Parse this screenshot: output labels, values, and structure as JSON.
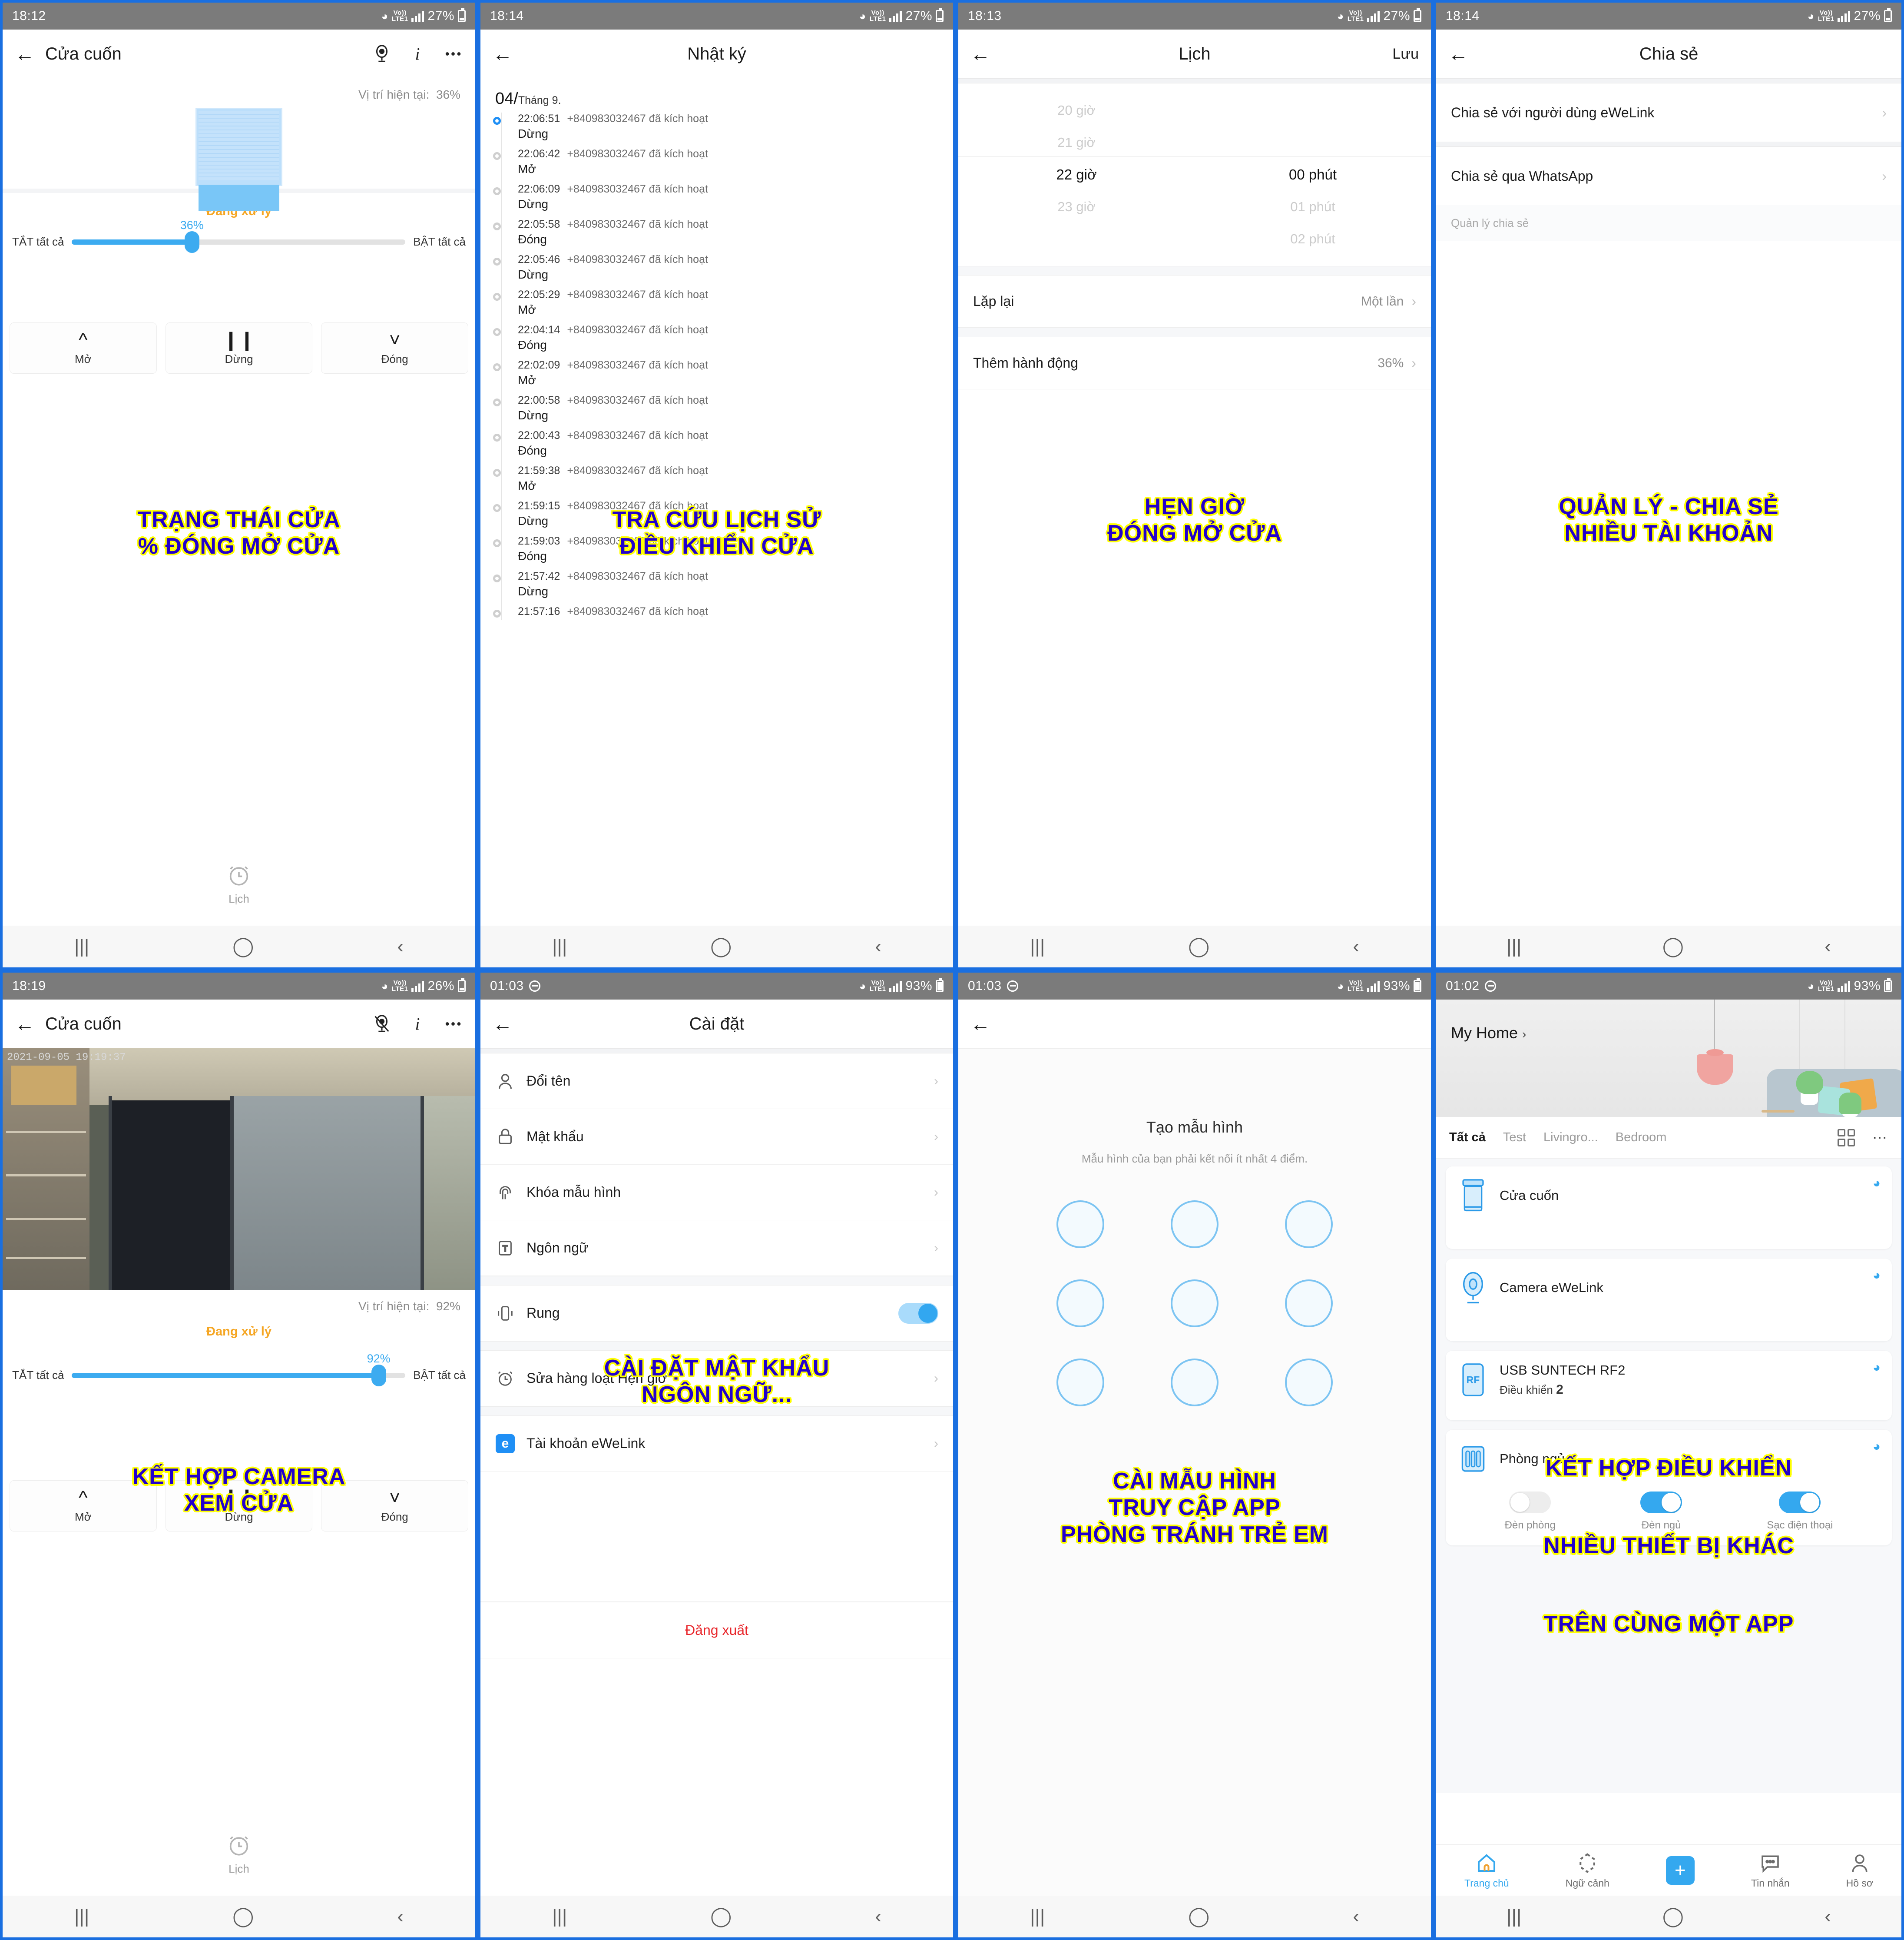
{
  "panels": {
    "cover": {
      "status": {
        "time": "18:12",
        "battery": "27%",
        "network": "LTE1"
      },
      "title": "Cửa cuốn",
      "position_label": "Vị trí hiện tại:",
      "position_value": "36%",
      "state_text": "Đang xử lý",
      "slider": {
        "value": "36%",
        "percent": 36,
        "left_label": "TẮT tất cả",
        "right_label": "BẬT tất cả"
      },
      "controls": [
        {
          "label": "Mở",
          "glyph": "⌃"
        },
        {
          "label": "Dừng",
          "glyph": "▐▌"
        },
        {
          "label": "Đóng",
          "glyph": "⌄"
        }
      ],
      "schedule_label": "Lịch",
      "caption": [
        "TRẠNG THÁI CỬA",
        "% ĐÓNG MỞ CỬA"
      ]
    },
    "log": {
      "status": {
        "time": "18:14",
        "battery": "27%",
        "network": "LTE1"
      },
      "title": "Nhật ký",
      "date_day": "04/",
      "date_month": "Tháng 9.",
      "actor": "+840983032467 đã kích hoạt",
      "entries": [
        {
          "time": "22:06:51",
          "action": "Dừng"
        },
        {
          "time": "22:06:42",
          "action": "Mở"
        },
        {
          "time": "22:06:09",
          "action": "Dừng"
        },
        {
          "time": "22:05:58",
          "action": "Đóng"
        },
        {
          "time": "22:05:46",
          "action": "Dừng"
        },
        {
          "time": "22:05:29",
          "action": "Mở"
        },
        {
          "time": "22:04:14",
          "action": "Đóng"
        },
        {
          "time": "22:02:09",
          "action": "Mở"
        },
        {
          "time": "22:00:58",
          "action": "Dừng"
        },
        {
          "time": "22:00:43",
          "action": "Đóng"
        },
        {
          "time": "21:59:38",
          "action": "Mở"
        },
        {
          "time": "21:59:15",
          "action": "Dừng"
        },
        {
          "time": "21:59:03",
          "action": "Đóng"
        },
        {
          "time": "21:57:42",
          "action": "Dừng"
        },
        {
          "time": "21:57:16",
          "action": ""
        }
      ],
      "caption": [
        "TRA CỨU LỊCH SỬ",
        "ĐIỀU KHIỂN CỬA"
      ]
    },
    "schedule": {
      "status": {
        "time": "18:13",
        "battery": "27%",
        "network": "LTE1"
      },
      "title": "Lịch",
      "save_label": "Lưu",
      "hours": [
        "20 giờ",
        "21 giờ",
        "22 giờ",
        "23 giờ"
      ],
      "selected_hour": "22 giờ",
      "minutes": [
        "00 phút",
        "01 phút",
        "02 phút"
      ],
      "selected_minute": "00 phút",
      "rows": [
        {
          "label": "Lặp lại",
          "value": "Một lần"
        },
        {
          "label": "Thêm hành động",
          "value": "36%"
        }
      ],
      "caption": [
        "HẸN GIỜ",
        "ĐÓNG MỞ CỬA"
      ]
    },
    "share": {
      "status": {
        "time": "18:14",
        "battery": "27%",
        "network": "LTE1"
      },
      "title": "Chia sẻ",
      "rows": [
        {
          "label": "Chia sẻ với người dùng eWeLink"
        },
        {
          "label": "Chia sẻ qua WhatsApp"
        }
      ],
      "section_caption": "Quản lý chia sẻ",
      "caption": [
        "QUẢN LÝ - CHIA SẺ",
        "NHIỀU TÀI KHOẢN"
      ]
    },
    "camera": {
      "status": {
        "time": "18:19",
        "battery": "26%",
        "network": "LTE1"
      },
      "title": "Cửa cuốn",
      "feed_timestamp": "2021-09-05 19:19:37",
      "position_label": "Vị trí hiện tại:",
      "position_value": "92%",
      "state_text": "Đang xử lý",
      "slider": {
        "value": "92%",
        "percent": 92,
        "left_label": "TẮT tất cả",
        "right_label": "BẬT tất cả"
      },
      "controls": [
        {
          "label": "Mở",
          "glyph": "⌃"
        },
        {
          "label": "Dừng",
          "glyph": "▐▌"
        },
        {
          "label": "Đóng",
          "glyph": "⌄"
        }
      ],
      "schedule_label": "Lịch",
      "caption": [
        "KẾT HỢP CAMERA",
        "XEM CỬA"
      ]
    },
    "settings": {
      "status": {
        "time": "01:03",
        "battery": "93%",
        "network": "LTE1"
      },
      "title": "Cài đặt",
      "rows": [
        {
          "label": "Đổi tên",
          "icon": "person-icon",
          "type": "chevron"
        },
        {
          "label": "Mật khẩu",
          "icon": "lock-icon",
          "type": "chevron"
        },
        {
          "label": "Khóa mẫu hình",
          "icon": "fingerprint-icon",
          "type": "chevron"
        },
        {
          "label": "Ngôn ngữ",
          "icon": "text-icon",
          "type": "chevron"
        },
        {
          "label": "Rung",
          "icon": "vibrate-icon",
          "type": "toggle",
          "toggle_on": true
        },
        {
          "label": "Sửa hàng loạt Hẹn giờ",
          "icon": "alarm-icon",
          "type": "chevron"
        },
        {
          "label": "Tài khoản eWeLink",
          "icon": "ewelink-icon",
          "type": "chevron"
        }
      ],
      "logout_label": "Đăng xuất",
      "caption": [
        "CÀI ĐẶT MẬT KHẨU",
        "NGÔN NGỮ..."
      ]
    },
    "pattern": {
      "status": {
        "time": "01:03",
        "battery": "93%",
        "network": "LTE1"
      },
      "title": "Tạo mẫu hình",
      "subtitle": "Mẫu hình của bạn phải kết nối ít nhất 4 điểm.",
      "dot_count": 9,
      "caption": [
        "CÀI MẪU HÌNH",
        "TRUY CẬP APP",
        "PHÒNG TRÁNH TRẺ EM"
      ]
    },
    "home": {
      "status": {
        "time": "01:02",
        "battery": "93%",
        "network": "LTE1"
      },
      "home_name": "My Home",
      "tabs": [
        "Tất cả",
        "Test",
        "Livingro...",
        "Bedroom"
      ],
      "active_tab": "Tất cả",
      "devices": [
        {
          "name": "Cửa cuốn",
          "icon": "roller-door-icon",
          "sub": "",
          "sub_value": ""
        },
        {
          "name": "Camera eWeLink",
          "icon": "camera-icon",
          "sub": "",
          "sub_value": ""
        },
        {
          "name": "USB SUNTECH RF2",
          "icon": "rf-icon",
          "sub": "Điều khiển",
          "sub_value": "2"
        }
      ],
      "room_card": {
        "name": "Phòng ngủ",
        "icon": "switch-panel-icon",
        "switches": [
          {
            "label": "Đèn phòng",
            "on": false
          },
          {
            "label": "Đèn ngủ",
            "on": true
          },
          {
            "label": "Sạc điện thoại",
            "on": true
          }
        ]
      },
      "bottom_nav": [
        {
          "label": "Trang chủ",
          "icon": "home-icon",
          "active": true
        },
        {
          "label": "Ngữ cảnh",
          "icon": "scene-icon",
          "active": false
        },
        {
          "label": "",
          "icon": "plus-icon",
          "active": false
        },
        {
          "label": "Tin nhắn",
          "icon": "message-icon",
          "active": false
        },
        {
          "label": "Hồ sơ",
          "icon": "profile-icon",
          "active": false
        }
      ],
      "caption": [
        "KẾT HỢP ĐIỀU KHIỂN",
        "NHIỀU THIẾT BỊ KHÁC",
        "TRÊN CÙNG MỘT APP"
      ]
    }
  },
  "colors": {
    "accent": "#34a8ef",
    "caption_fill": "#2200cc",
    "caption_stroke": "#ffff00",
    "warn": "#f5a623",
    "danger": "#e8262b"
  }
}
